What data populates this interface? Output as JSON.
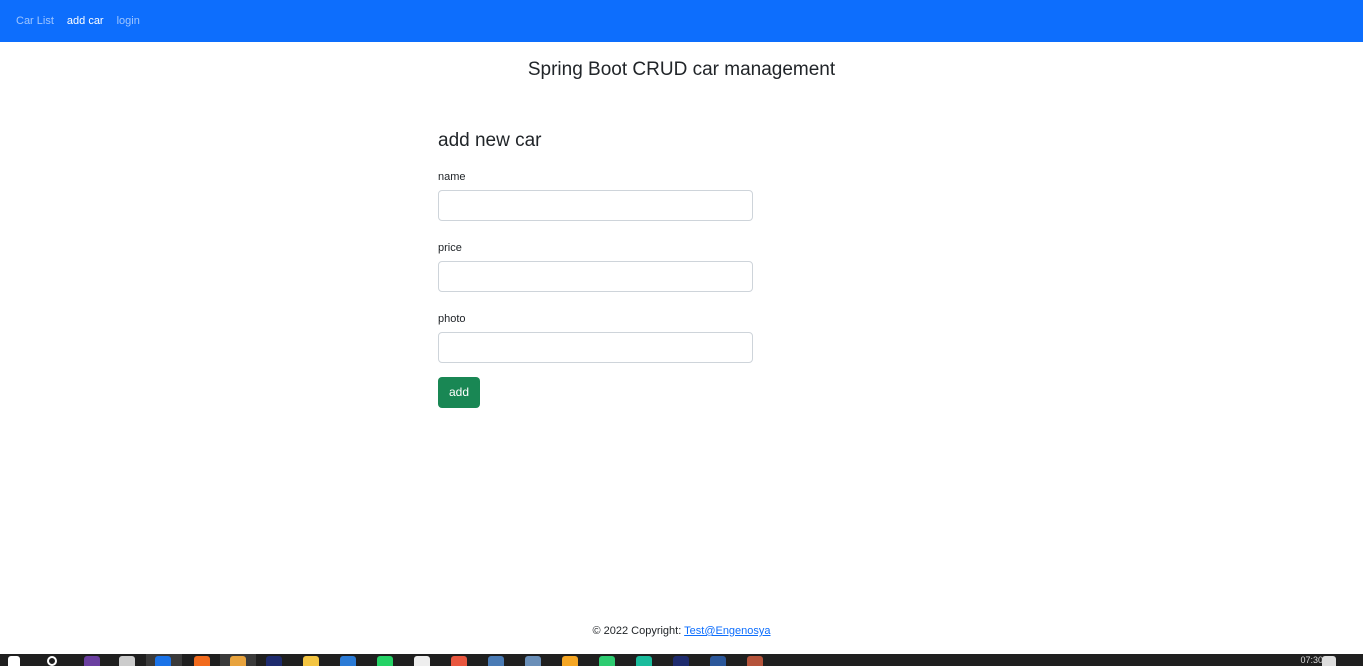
{
  "navbar": {
    "items": [
      {
        "label": "Car List",
        "active": false
      },
      {
        "label": "add car",
        "active": true
      },
      {
        "label": "login",
        "active": false
      }
    ],
    "background": "#0d6efd"
  },
  "page": {
    "heading": "Spring Boot CRUD car management"
  },
  "form": {
    "title": "add new car",
    "fields": [
      {
        "label": "name",
        "value": "",
        "placeholder": ""
      },
      {
        "label": "price",
        "value": "",
        "placeholder": ""
      },
      {
        "label": "photo",
        "value": "",
        "placeholder": ""
      }
    ],
    "submit_label": "add",
    "submit_color": "#198754"
  },
  "footer": {
    "copyright_text": "© 2022 Copyright: ",
    "link_text": "Test@Engenosya"
  },
  "taskbar": {
    "icons": [
      "windows-start-icon",
      "search-icon",
      "obs-icon",
      "store-icon",
      "chrome-icon",
      "postman-icon",
      "pen-icon",
      "intellij-icon",
      "file-explorer-icon",
      "vscode-icon",
      "whatsapp-icon",
      "notepad-icon",
      "git-icon",
      "terminal-icon",
      "github-icon",
      "app-icon",
      "app-icon-2",
      "app-icon-3",
      "intellij-icon-2",
      "word-icon",
      "misc-icon"
    ],
    "tray_time": "07:30"
  }
}
